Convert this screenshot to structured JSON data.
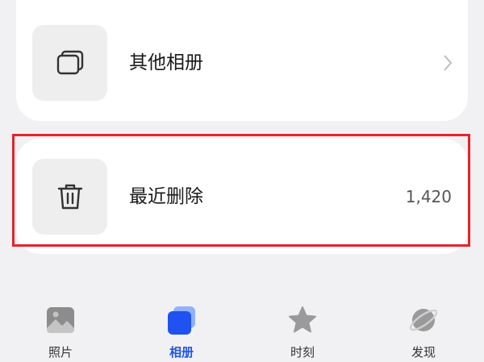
{
  "albums": {
    "other": {
      "label": "其他相册",
      "icon": "albums-stack-icon"
    },
    "recently_deleted": {
      "label": "最近删除",
      "count": "1,420",
      "icon": "trash-icon"
    }
  },
  "tabs": [
    {
      "label": "照片",
      "icon": "photo-icon",
      "active": false
    },
    {
      "label": "相册",
      "icon": "album-icon",
      "active": true
    },
    {
      "label": "时刻",
      "icon": "star-icon",
      "active": false
    },
    {
      "label": "发现",
      "icon": "planet-icon",
      "active": false
    }
  ],
  "colors": {
    "accent": "#2255e6",
    "highlight_border": "#e8222a",
    "background": "#f1f1f3"
  }
}
